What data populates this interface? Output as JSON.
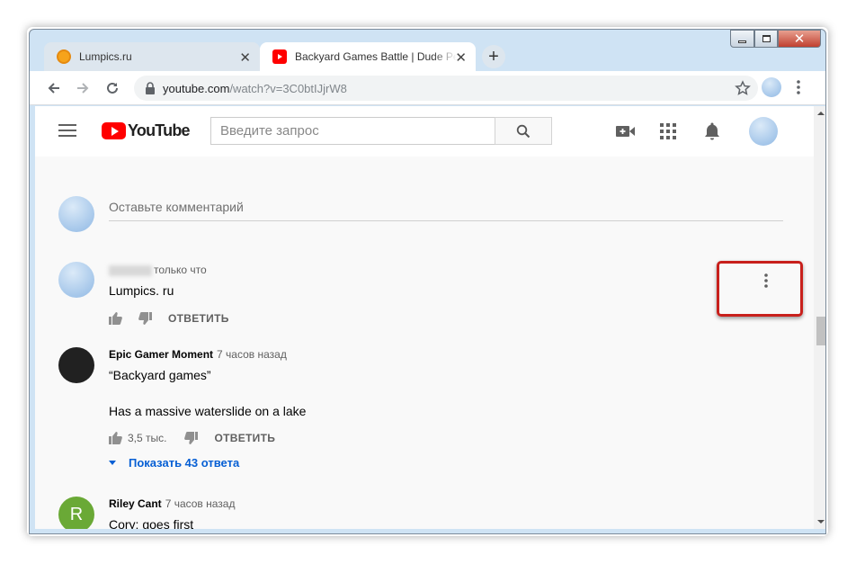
{
  "window": {
    "controls": {
      "minimize": "minimize-icon",
      "maximize": "maximize-icon",
      "close": "✕"
    }
  },
  "tabs": [
    {
      "title": "Lumpics.ru",
      "favicon": "orange-circle-icon",
      "active": false
    },
    {
      "title": "Backyard Games Battle | Dude Pe",
      "favicon": "youtube-icon",
      "active": true
    }
  ],
  "tab_close_glyph": "✕",
  "new_tab_glyph": "+",
  "toolbar": {
    "url_host": "youtube.com",
    "url_path": "/watch?v=3C0btIJjrW8"
  },
  "youtube": {
    "logo_text": "YouTube",
    "search_placeholder": "Введите запрос"
  },
  "comments": {
    "add_placeholder": "Оставьте комментарий",
    "items": [
      {
        "time": "только что",
        "text": "Lumpics. ru",
        "reply_label": "ОТВЕТИТЬ"
      },
      {
        "author": "Epic Gamer Moment",
        "time": "7 часов назад",
        "text_1": "“Backyard games”",
        "text_2": "Has a massive waterslide on a lake",
        "likes": "3,5 тыс.",
        "reply_label": "ОТВЕТИТЬ",
        "show_replies": "Показать 43 ответа"
      },
      {
        "author": "Riley Cant",
        "avatar_letter": "R",
        "time": "7 часов назад",
        "text": "Cory: goes first"
      }
    ]
  },
  "colors": {
    "youtube_red": "#ff0000",
    "link_blue": "#065fd4",
    "highlight_red": "#c8201c",
    "avatar_green": "#6aa936"
  }
}
